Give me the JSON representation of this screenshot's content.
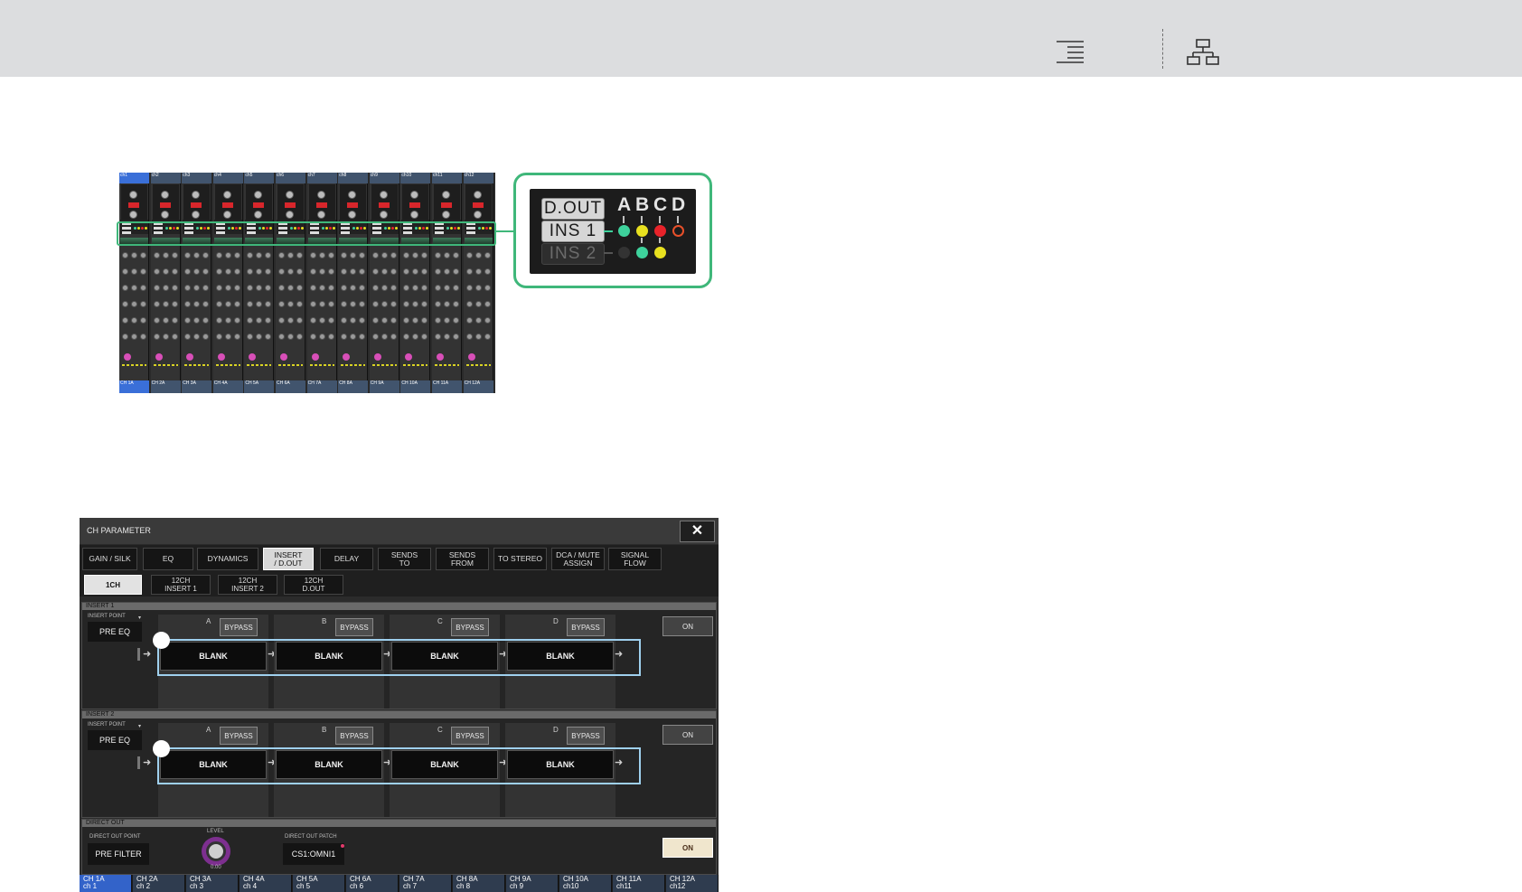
{
  "toolbar": {
    "icons": [
      "text-align-right-icon",
      "hierarchy-icon"
    ],
    "colors": {
      "background": "#dcdddf"
    }
  },
  "overview": {
    "channel_names": [
      "ch1",
      "ch2",
      "ch3",
      "ch4",
      "ch5",
      "ch6",
      "ch7",
      "ch8",
      "ch9",
      "ch10",
      "ch11",
      "ch12"
    ],
    "channel_footers": [
      "CH 1A",
      "CH 2A",
      "CH 3A",
      "CH 4A",
      "CH 5A",
      "CH 6A",
      "CH 7A",
      "CH 8A",
      "CH 9A",
      "CH 10A",
      "CH 11A",
      "CH 12A"
    ],
    "highlight_color": "#3fb77a"
  },
  "zoom": {
    "dout_label": "D.OUT",
    "ins1_label": "INS 1",
    "ins2_label": "INS 2",
    "slot_letters": [
      "A",
      "B",
      "C",
      "D"
    ],
    "ins1_dots": [
      "#3ed29c",
      "#e8e01f",
      "#e8232a",
      "ring-red"
    ],
    "ins2_dots": [
      "dark",
      "#3ed29c",
      "#e8e01f"
    ]
  },
  "window": {
    "title": "CH PARAMETER",
    "close_label": "✕",
    "tabs": [
      "GAIN / SILK",
      "EQ",
      "DYNAMICS",
      "INSERT\n/ D.OUT",
      "DELAY",
      "SENDS\nTO",
      "SENDS\nFROM",
      "TO STEREO",
      "DCA / MUTE\nASSIGN",
      "SIGNAL\nFLOW"
    ],
    "active_tab": "INSERT\n/ D.OUT",
    "subtabs": [
      "1CH",
      "12CH\nINSERT 1",
      "12CH\nINSERT 2",
      "12CH\nD.OUT"
    ],
    "active_subtab": "1CH",
    "insert1": {
      "header": "INSERT 1",
      "insert_point_label": "INSERT POINT",
      "insert_point_value": "PRE EQ",
      "slots": [
        {
          "letter": "A",
          "bypass": "BYPASS",
          "plugin": "BLANK"
        },
        {
          "letter": "B",
          "bypass": "BYPASS",
          "plugin": "BLANK"
        },
        {
          "letter": "C",
          "bypass": "BYPASS",
          "plugin": "BLANK"
        },
        {
          "letter": "D",
          "bypass": "BYPASS",
          "plugin": "BLANK"
        }
      ],
      "on_label": "ON"
    },
    "insert2": {
      "header": "INSERT 2",
      "insert_point_label": "INSERT POINT",
      "insert_point_value": "PRE EQ",
      "slots": [
        {
          "letter": "A",
          "bypass": "BYPASS",
          "plugin": "BLANK"
        },
        {
          "letter": "B",
          "bypass": "BYPASS",
          "plugin": "BLANK"
        },
        {
          "letter": "C",
          "bypass": "BYPASS",
          "plugin": "BLANK"
        },
        {
          "letter": "D",
          "bypass": "BYPASS",
          "plugin": "BLANK"
        }
      ],
      "on_label": "ON"
    },
    "direct_out": {
      "header": "DIRECT OUT",
      "point_label": "DIRECT OUT POINT",
      "point_value": "PRE FILTER",
      "level_label": "LEVEL",
      "level_value": "0.00",
      "patch_label": "DIRECT OUT PATCH",
      "patch_value": "CS1:OMNI1",
      "on_label": "ON"
    },
    "channel_bar": [
      {
        "top": "CH 1A",
        "bottom": "ch 1"
      },
      {
        "top": "CH 2A",
        "bottom": "ch 2"
      },
      {
        "top": "CH 3A",
        "bottom": "ch 3"
      },
      {
        "top": "CH 4A",
        "bottom": "ch 4"
      },
      {
        "top": "CH 5A",
        "bottom": "ch 5"
      },
      {
        "top": "CH 6A",
        "bottom": "ch 6"
      },
      {
        "top": "CH 7A",
        "bottom": "ch 7"
      },
      {
        "top": "CH 8A",
        "bottom": "ch 8"
      },
      {
        "top": "CH 9A",
        "bottom": "ch 9"
      },
      {
        "top": "CH 10A",
        "bottom": "ch10"
      },
      {
        "top": "CH 11A",
        "bottom": "ch11"
      },
      {
        "top": "CH 12A",
        "bottom": "ch12"
      }
    ],
    "selected_channel": "CH 1A",
    "colors": {
      "selection_blue": "#3363c9",
      "highlight": "#9fd0ee",
      "on_lit": "#f0e6cd"
    }
  }
}
